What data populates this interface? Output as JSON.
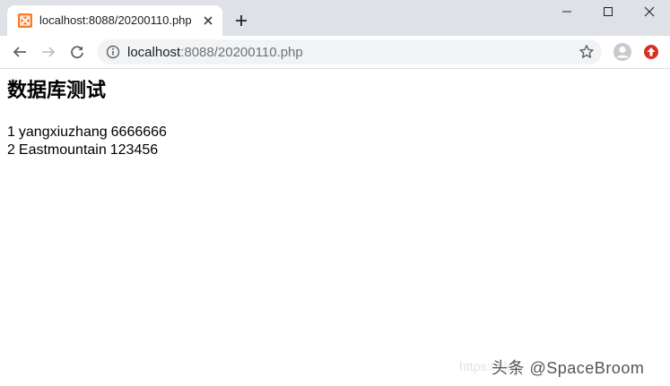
{
  "browser": {
    "tab": {
      "title": "localhost:8088/20200110.php"
    },
    "address_bar": {
      "host": "localhost",
      "path": ":8088/20200110.php"
    }
  },
  "page": {
    "heading": "数据库测试",
    "records": [
      {
        "id": "1",
        "name": "yangxiuzhang",
        "password": "6666666"
      },
      {
        "id": "2",
        "name": "Eastmountain",
        "password": "123456"
      }
    ]
  },
  "watermark": {
    "faint": "https://blog",
    "main": "头条 @SpaceBroom"
  },
  "colors": {
    "tab_strip": "#dee1e6",
    "favicon": "#fb7a24",
    "omnibox": "#f1f3f4",
    "extension_badge": "#d93025"
  },
  "icons": {
    "favicon": "xampp-icon",
    "tab_close": "close-icon",
    "new_tab": "plus-icon",
    "back": "arrow-left-icon",
    "forward": "arrow-right-icon",
    "reload": "reload-icon",
    "site_info": "info-icon",
    "bookmark": "star-icon",
    "profile": "account-icon",
    "extension": "upload-icon"
  }
}
